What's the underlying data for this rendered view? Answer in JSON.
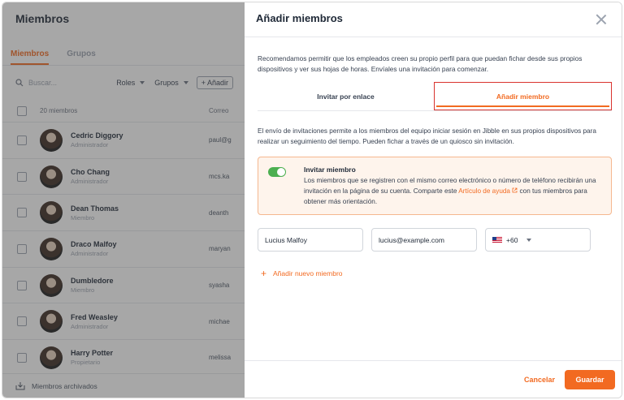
{
  "background": {
    "title": "Miembros",
    "tabs": [
      {
        "label": "Miembros",
        "active": true
      },
      {
        "label": "Grupos",
        "active": false
      }
    ],
    "search_placeholder": "Buscar...",
    "filters": [
      "Roles",
      "Grupos"
    ],
    "add_label": "Añadir",
    "member_count": "20 miembros",
    "email_column": "Correo",
    "members": [
      {
        "name": "Cedric Diggory",
        "role": "Administrador",
        "email": "paul@g"
      },
      {
        "name": "Cho Chang",
        "role": "Administrador",
        "email": "mcs.ka"
      },
      {
        "name": "Dean Thomas",
        "role": "Miembro",
        "email": "deanth"
      },
      {
        "name": "Draco Malfoy",
        "role": "Administrador",
        "email": "maryan"
      },
      {
        "name": "Dumbledore",
        "role": "Miembro",
        "email": "syasha"
      },
      {
        "name": "Fred Weasley",
        "role": "Administrador",
        "email": "michae"
      },
      {
        "name": "Harry Potter",
        "role": "Propietario",
        "email": "melissa"
      }
    ],
    "archived_label": "Miembros archivados"
  },
  "modal": {
    "title": "Añadir miembros",
    "intro": "Recomendamos permitir que los empleados creen su propio perfil para que puedan fichar desde sus propios dispositivos y ver sus hojas de horas. Envíales una invitación para comenzar.",
    "tabs": [
      {
        "label": "Invitar por enlace",
        "active": false
      },
      {
        "label": "Añadir miembro",
        "active": true
      }
    ],
    "description": "El envío de invitaciones permite a los miembros del equipo iniciar sesión en Jibble en sus propios dispositivos para realizar un seguimiento del tiempo. Pueden fichar a través de un quiosco sin invitación.",
    "notice": {
      "title": "Invitar miembro",
      "toggle_on": true,
      "text_before": "Los miembros que se registren con el mismo correo electrónico o número de teléfono recibirán una invitación en la página de su cuenta. Comparte este ",
      "link": "Artículo de ayuda",
      "text_after": " con tus miembros para obtener más orientación."
    },
    "inputs": {
      "name": "Lucius Malfoy",
      "email": "lucius@example.com",
      "phone_code": "+60"
    },
    "add_new_label": "Añadir nuevo miembro",
    "cancel_label": "Cancelar",
    "save_label": "Guardar"
  },
  "colors": {
    "accent": "#f26a21",
    "highlight_border": "#d9332e",
    "toggle": "#4caf50"
  }
}
